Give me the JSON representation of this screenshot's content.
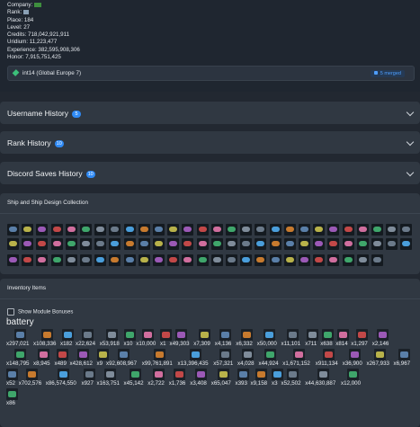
{
  "player": {
    "company_label": "Company:",
    "rank_label": "Rank:",
    "place": "Place: 184",
    "level": "Level: 27",
    "credits": "Credits: 718,042,921,911",
    "uridium": "Uridium: 11,223,477",
    "experience": "Experience: 382,595,908,306",
    "honor": "Honor: 7,915,751,425"
  },
  "server": {
    "name": "int14 (Global Europe 7)",
    "merged": "5 merged"
  },
  "sections": [
    {
      "title": "Username History",
      "count": "5"
    },
    {
      "title": "Rank History",
      "count": "10"
    },
    {
      "title": "Discord Saves History",
      "count": "10"
    }
  ],
  "ships_section": {
    "title": "Ship and Ship Design Collection"
  },
  "inventory": {
    "title": "Inventory Items",
    "module_toggle": "Show Module Bonuses",
    "category": "battery",
    "rows": [
      [
        "x297,021",
        "x108,336",
        "x182",
        "x22,624",
        "x53,918",
        "x10",
        "x10,000",
        "x1",
        "x49,303",
        "x7,309",
        "x4,136",
        "x6,332",
        "x50,000",
        "x11,101",
        "x711",
        "x638",
        "x814",
        "x1,297",
        "x2,146"
      ],
      [
        "x148,795",
        "x8,945",
        "x489",
        "x428,612",
        "x9",
        "x92,608,967",
        "x99,761,891",
        "x13,396,435",
        "x57,321",
        "x4,028",
        "x44,924",
        "x1,671,152",
        "x911,134",
        "x36,900",
        "x267,933",
        "x6,967"
      ],
      [
        "x52",
        "x702,576",
        "x86,574,550",
        "x927",
        "x163,751",
        "x45,142",
        "x2,722",
        "x1,736",
        "x3,408",
        "x65,047",
        "x393",
        "x9,158",
        "x3",
        "x52,502",
        "x44,630,887",
        "x12,000"
      ],
      [
        "x86"
      ]
    ]
  },
  "colors": {
    "accent": "#2f8af5",
    "background": "#222831",
    "panel": "#303842"
  }
}
